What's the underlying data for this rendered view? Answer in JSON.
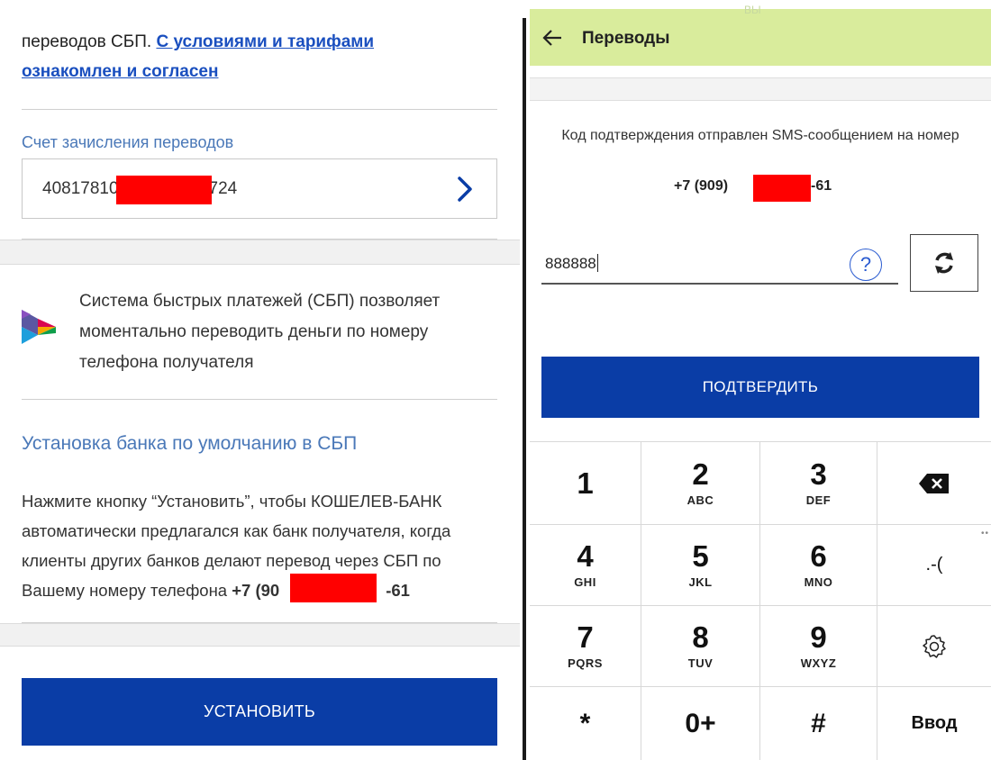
{
  "left": {
    "terms": {
      "prefix": "переводов СБП. ",
      "link_line1": "С условиями и тарифами",
      "link_line2": "ознакомлен и согласен"
    },
    "account": {
      "label": "Счет зачисления переводов",
      "number_start": "40817810",
      "number_end": "724"
    },
    "sbp": {
      "description": "Система быстрых платежей (СБП) позволяет моментально переводить деньги по номеру телефона получателя"
    },
    "default_bank": {
      "title": "Установка банка по умолчанию в СБП",
      "description": "Нажмите кнопку “Установить”, чтобы КОШЕЛЕВ-БАНК автоматически предлагался как банк получателя, когда клиенты других банков делают перевод через СБП по Вашему номеру телефона ",
      "phone_start": "+7 (90",
      "phone_end": "-61"
    },
    "install_button": "УСТАНОВИТЬ"
  },
  "right": {
    "appbar": {
      "title": "Переводы",
      "faded_tag": "ВЫ"
    },
    "sms": {
      "message": "Код подтверждения отправлен SMS-сообщением на номер",
      "phone_start": "+7 (909)",
      "phone_end": "-61"
    },
    "code_input": {
      "value": "888888"
    },
    "help_symbol": "?",
    "confirm_button": "ПОДТВЕРДИТЬ",
    "keypad": {
      "k1": "1",
      "k2": "2",
      "k2_letters": "ABC",
      "k3": "3",
      "k3_letters": "DEF",
      "k4": "4",
      "k4_letters": "GHI",
      "k5": "5",
      "k5_letters": "JKL",
      "k6": "6",
      "k6_letters": "MNO",
      "k_punct": ".-(",
      "k7": "7",
      "k7_letters": "PQRS",
      "k8": "8",
      "k8_letters": "TUV",
      "k9": "9",
      "k9_letters": "WXYZ",
      "k_star": "*",
      "k0": "0+",
      "k_hash": "#",
      "k_enter": "Ввод"
    }
  },
  "colors": {
    "primary_button": "#0a3da6",
    "link": "#1a4fbf",
    "section_label": "#4a78b8",
    "appbar": "#d9ec9c",
    "redaction": "#ff0000"
  },
  "icons": [
    "chevron-right-icon",
    "sbp-logo-icon",
    "back-arrow-icon",
    "help-icon",
    "refresh-icon",
    "backspace-icon",
    "gear-icon"
  ]
}
